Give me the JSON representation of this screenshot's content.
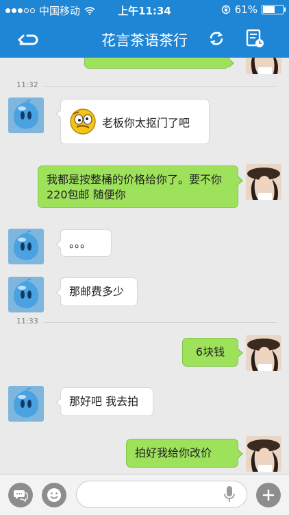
{
  "status_bar": {
    "carrier": "中国移动",
    "time": "上午11:34",
    "battery": "61%",
    "battery_level": 0.61
  },
  "header": {
    "title": "花言茶语茶行",
    "back_icon": "back-arrow-icon",
    "refresh_icon": "refresh-icon",
    "notes_icon": "notes-icon"
  },
  "chat": {
    "timestamps": [
      "11:32",
      "11:33"
    ],
    "messages": [
      {
        "direction": "out",
        "text": "我都是按整桶的价格给你了。要不你220包邮 随便你"
      },
      {
        "direction": "in",
        "text": "老板你太抠门了吧",
        "emoji": "dizzy-face-emoji"
      },
      {
        "direction": "in",
        "text": "。。。"
      },
      {
        "direction": "in",
        "text": "那邮费多少"
      },
      {
        "direction": "out",
        "text": "6块钱"
      },
      {
        "direction": "in",
        "text": "那好吧 我去拍"
      },
      {
        "direction": "out",
        "text": "拍好我给你改价"
      }
    ]
  },
  "input_bar": {
    "value": "",
    "placeholder": "",
    "left_icons": [
      "chat-bubble-icon",
      "smiley-icon"
    ],
    "mic_icon": "microphone-icon",
    "plus_icon": "plus-icon"
  },
  "colors": {
    "header_blue": "#1f86d6",
    "outgoing_bubble": "#9ee25c",
    "incoming_bubble": "#ffffff",
    "background": "#eaeaea"
  }
}
